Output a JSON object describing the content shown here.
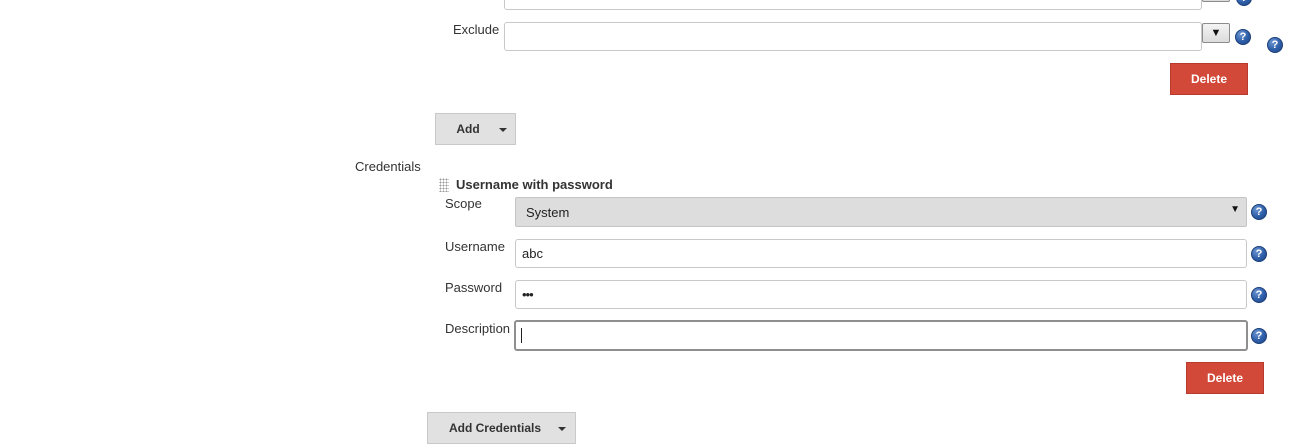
{
  "filters": {
    "exclude_label": "Exclude",
    "exclude_value": "",
    "dropdown_glyph": "▼",
    "delete_label": "Delete",
    "add_label": "Add"
  },
  "credentials": {
    "section_label": "Credentials",
    "entry_title": "Username with password",
    "scope": {
      "label": "Scope",
      "selected": "System"
    },
    "username": {
      "label": "Username",
      "value": "abc"
    },
    "password": {
      "label": "Password",
      "value": "•••"
    },
    "description": {
      "label": "Description",
      "value": ""
    },
    "delete_label": "Delete",
    "add_label": "Add Credentials"
  },
  "icons": {
    "help": "help-icon",
    "caret": "caret-down-icon",
    "drag": "drag-handle-icon"
  },
  "colors": {
    "delete_button": "#d24939",
    "help_icon": "#2e5ea8",
    "gray_button": "#e1e1e1",
    "select_background": "#dddddd"
  }
}
